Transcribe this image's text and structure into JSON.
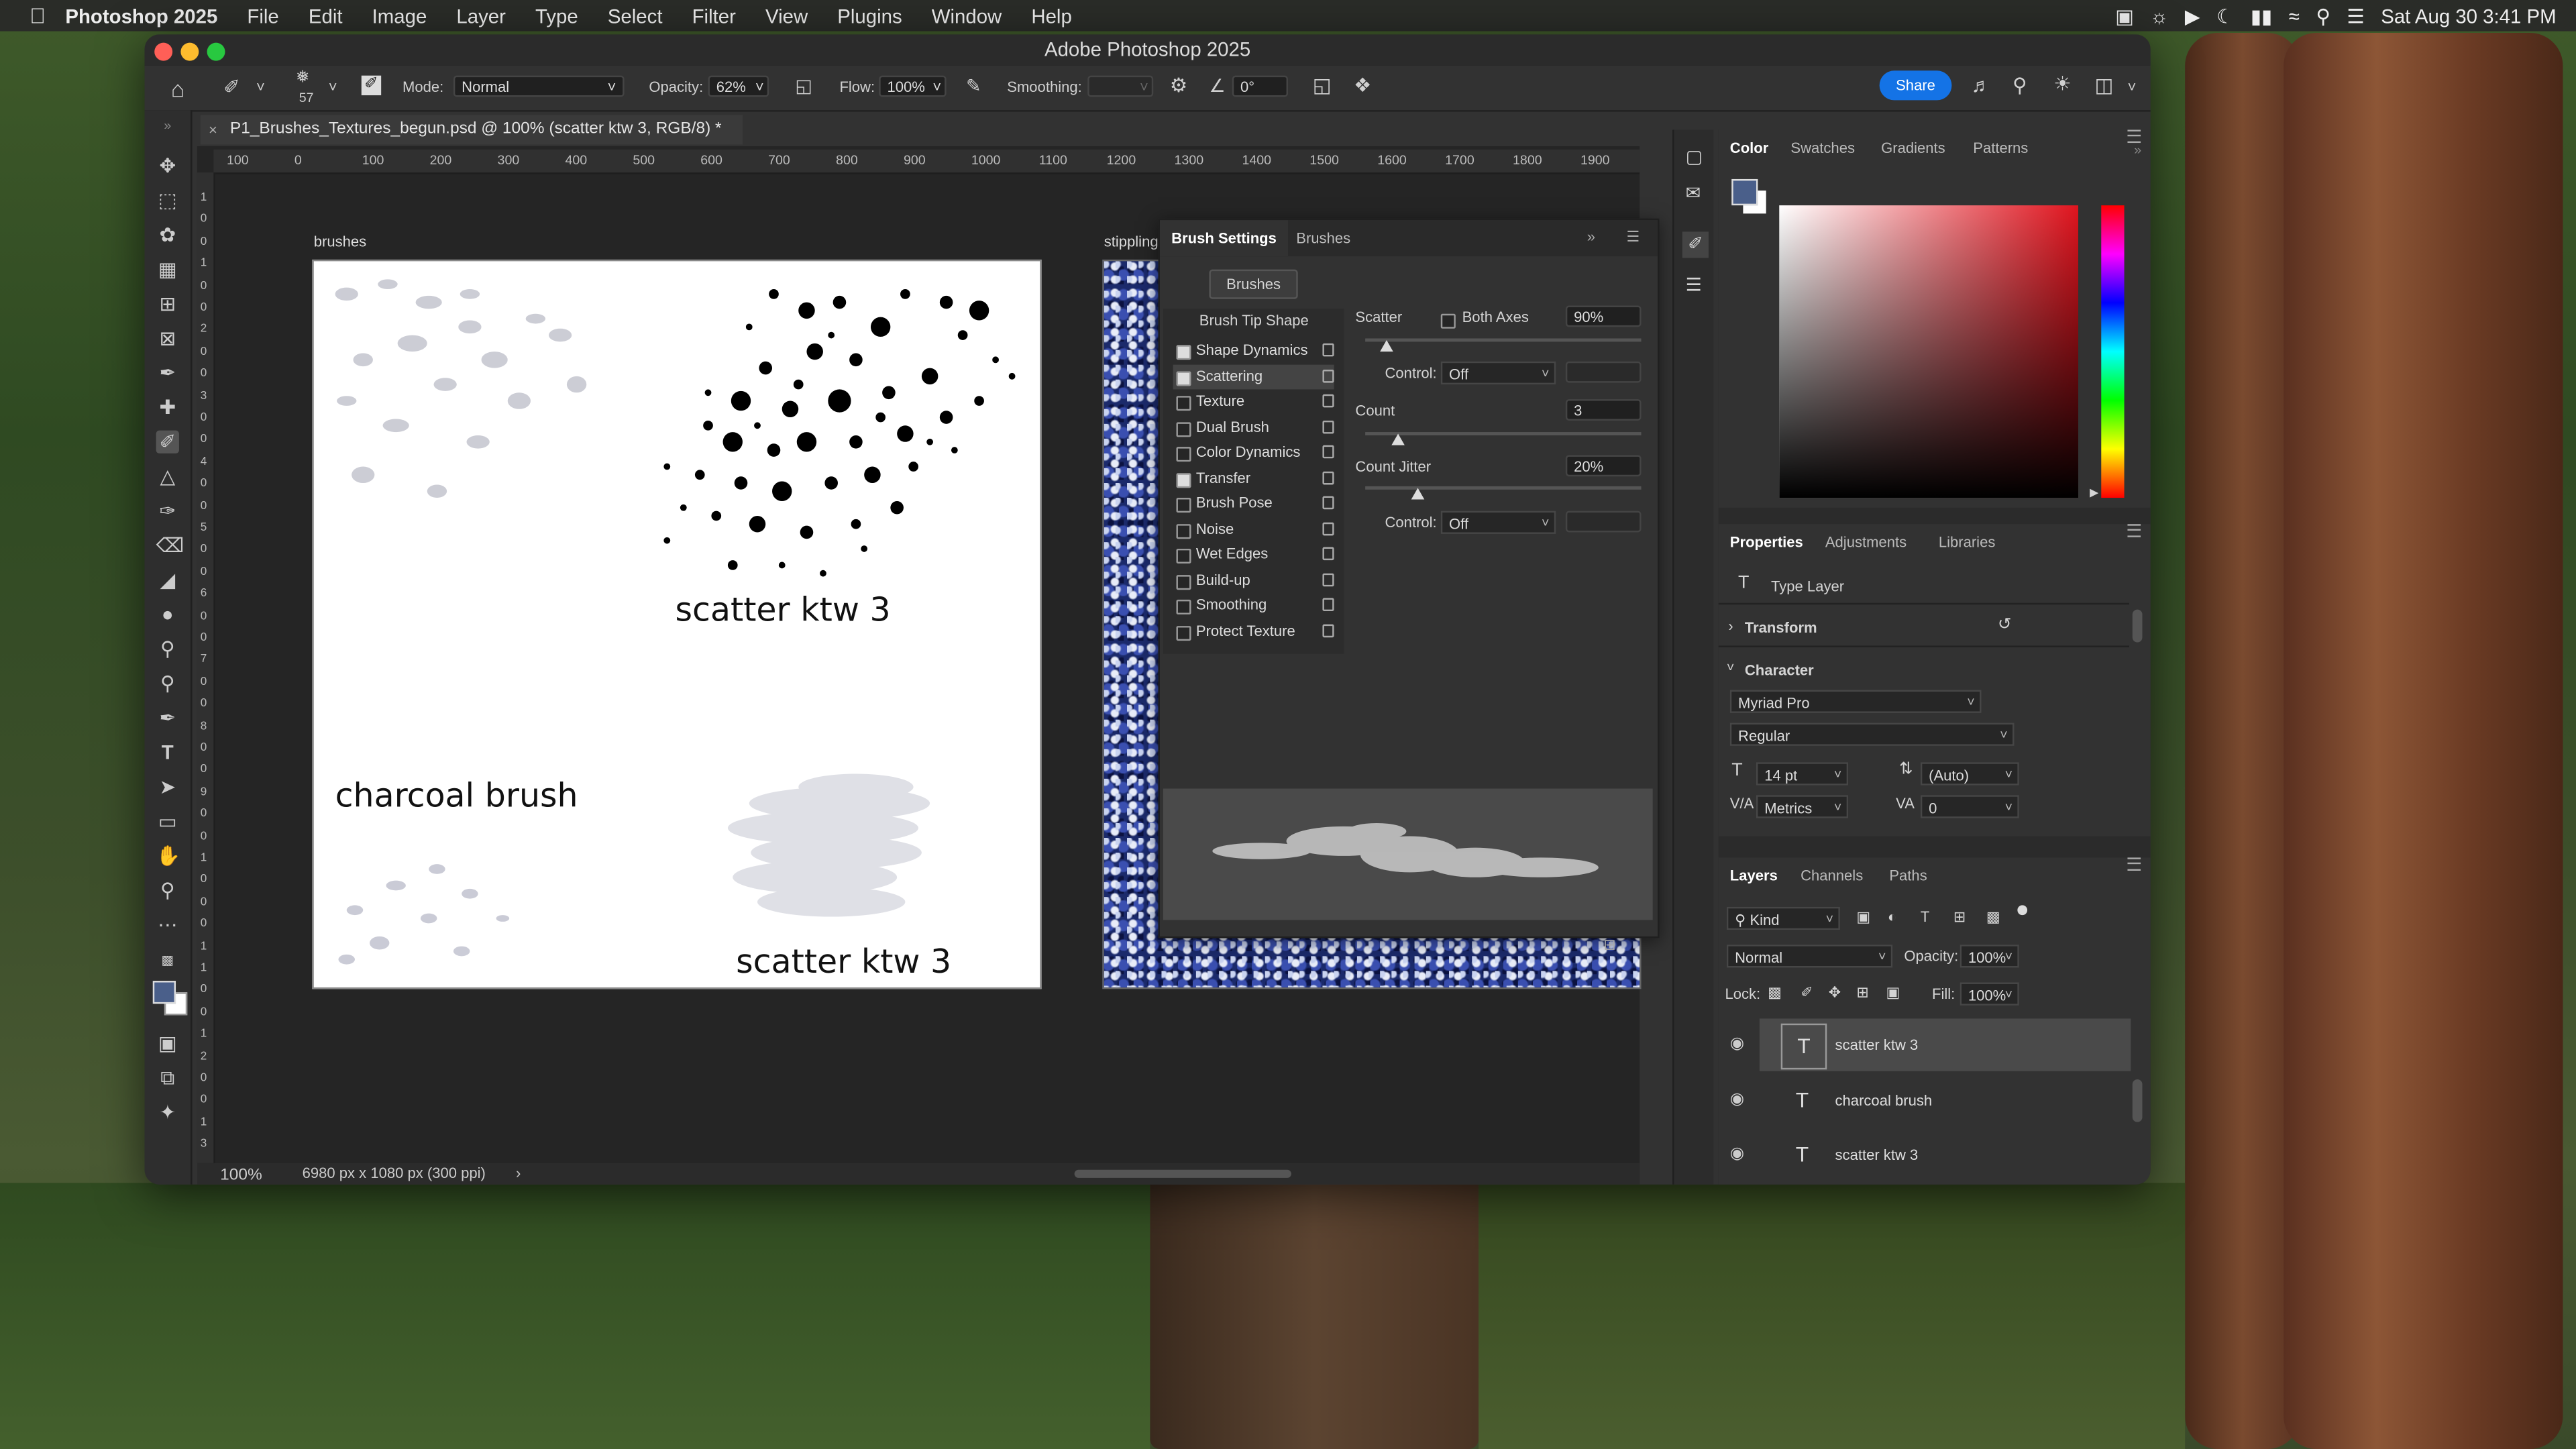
{
  "menubar": {
    "app_name": "Photoshop 2025",
    "items": [
      "File",
      "Edit",
      "Image",
      "Layer",
      "Type",
      "Select",
      "Filter",
      "View",
      "Plugins",
      "Window",
      "Help"
    ],
    "clock": "Sat Aug 30  3:41 PM"
  },
  "window": {
    "title": "Adobe Photoshop 2025"
  },
  "options_bar": {
    "brush_size": "57",
    "mode_label": "Mode:",
    "mode_value": "Normal",
    "opacity_label": "Opacity:",
    "opacity_value": "62%",
    "flow_label": "Flow:",
    "flow_value": "100%",
    "smoothing_label": "Smoothing:",
    "smoothing_value": "",
    "angle_value": "0°",
    "share_label": "Share"
  },
  "document": {
    "tab_title": "P1_Brushes_Textures_begun.psd @ 100% (scatter ktw 3, RGB/8) *",
    "ruler_h_ticks": [
      "100",
      "0",
      "100",
      "200",
      "300",
      "400",
      "500",
      "600",
      "700",
      "800",
      "900",
      "1000",
      "1100",
      "1200",
      "1300",
      "1400",
      "1500",
      "1600",
      "1700",
      "1800",
      "1900"
    ],
    "ruler_v_ticks": [
      "1",
      "0",
      "0",
      "1",
      "0",
      "0",
      "2",
      "0",
      "0",
      "3",
      "0",
      "0",
      "4",
      "0",
      "0",
      "5",
      "0",
      "0",
      "6",
      "0",
      "0",
      "7",
      "0",
      "0",
      "8",
      "0",
      "0",
      "9",
      "0",
      "0",
      "1",
      "0",
      "0",
      "0",
      "1",
      "1",
      "0",
      "0",
      "1",
      "2",
      "0",
      "0",
      "1",
      "3"
    ],
    "artboard1_label": "brushes",
    "artboard2_label": "stippling",
    "text_scatter_top": "scatter ktw 3",
    "text_charcoal": "charcoal brush",
    "text_scatter_bottom": "scatter ktw 3",
    "zoom": "100%",
    "doc_info": "6980 px x 1080 px (300 ppi)"
  },
  "brush_settings": {
    "tab_active": "Brush Settings",
    "tab_other": "Brushes",
    "brushes_button": "Brushes",
    "brush_tip_shape": "Brush Tip Shape",
    "options": [
      {
        "label": "Shape Dynamics",
        "checked": true
      },
      {
        "label": "Scattering",
        "checked": true
      },
      {
        "label": "Texture",
        "checked": false
      },
      {
        "label": "Dual Brush",
        "checked": false
      },
      {
        "label": "Color Dynamics",
        "checked": false
      },
      {
        "label": "Transfer",
        "checked": true
      },
      {
        "label": "Brush Pose",
        "checked": false
      },
      {
        "label": "Noise",
        "checked": false
      },
      {
        "label": "Wet Edges",
        "checked": false
      },
      {
        "label": "Build-up",
        "checked": false
      },
      {
        "label": "Smoothing",
        "checked": false
      },
      {
        "label": "Protect Texture",
        "checked": false
      }
    ],
    "scatter_label": "Scatter",
    "both_axes_label": "Both Axes",
    "scatter_value": "90%",
    "control_label": "Control:",
    "control_value_1": "Off",
    "count_label": "Count",
    "count_value": "3",
    "count_jitter_label": "Count Jitter",
    "count_jitter_value": "20%",
    "control_value_2": "Off"
  },
  "color_panel": {
    "tabs": [
      "Color",
      "Swatches",
      "Gradients",
      "Patterns"
    ],
    "hue_color": "#e0141e",
    "foreground_color": "#4a5f8a"
  },
  "properties_panel": {
    "tabs": [
      "Properties",
      "Adjustments",
      "Libraries"
    ],
    "layer_type": "Type Layer",
    "transform_label": "Transform",
    "character_label": "Character",
    "font_family": "Myriad Pro",
    "font_style": "Regular",
    "font_size": "14 pt",
    "leading": "(Auto)",
    "kerning": "Metrics",
    "tracking": "0"
  },
  "layers_panel": {
    "tabs": [
      "Layers",
      "Channels",
      "Paths"
    ],
    "filter_kind": "Kind",
    "blend_mode": "Normal",
    "opacity_label": "Opacity:",
    "opacity_value": "100%",
    "lock_label": "Lock:",
    "fill_label": "Fill:",
    "fill_value": "100%",
    "layers": [
      {
        "name": "scatter ktw 3",
        "selected": true
      },
      {
        "name": "charcoal brush",
        "selected": false
      },
      {
        "name": "scatter ktw 3",
        "selected": false
      }
    ]
  }
}
